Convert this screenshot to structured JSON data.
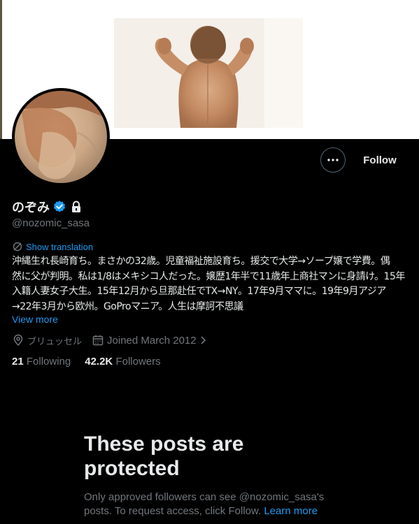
{
  "profile": {
    "display_name": "のぞみ",
    "handle": "@nozomic_sasa",
    "show_translation": "Show translation",
    "bio_lines": [
      "沖縄生れ長崎育ち。まさかの32歳。児童福祉施設育ち。援交で大学→ソープ嬢で学費。偶",
      "然に父が判明。私は1/8はメキシコ人だった。嬢歴1年半で11歳年上商社マンに身請け。15年",
      "入籍人妻女子大生。15年12月から旦那赴任でTX→NY。17年9月ママに。19年9月アジア",
      "→22年3月から欧州。GoProマニア。人生は摩訶不思議"
    ],
    "view_more": "View more",
    "location": "ブリュッセル",
    "joined": "Joined March 2012",
    "following_count": "21",
    "following_label": "Following",
    "followers_count": "42.2K",
    "followers_label": "Followers"
  },
  "actions": {
    "follow_label": "Follow",
    "more_icon": "more-horizontal-icon"
  },
  "protected": {
    "title": "These posts are protected",
    "description": "Only approved followers can see @nozomic_sasa's posts. To request access, click Follow.",
    "learn_more": "Learn more"
  },
  "colors": {
    "background": "#000000",
    "accent": "#1d9bf0",
    "text_primary": "#e7e9ea",
    "text_secondary": "#71767b"
  }
}
